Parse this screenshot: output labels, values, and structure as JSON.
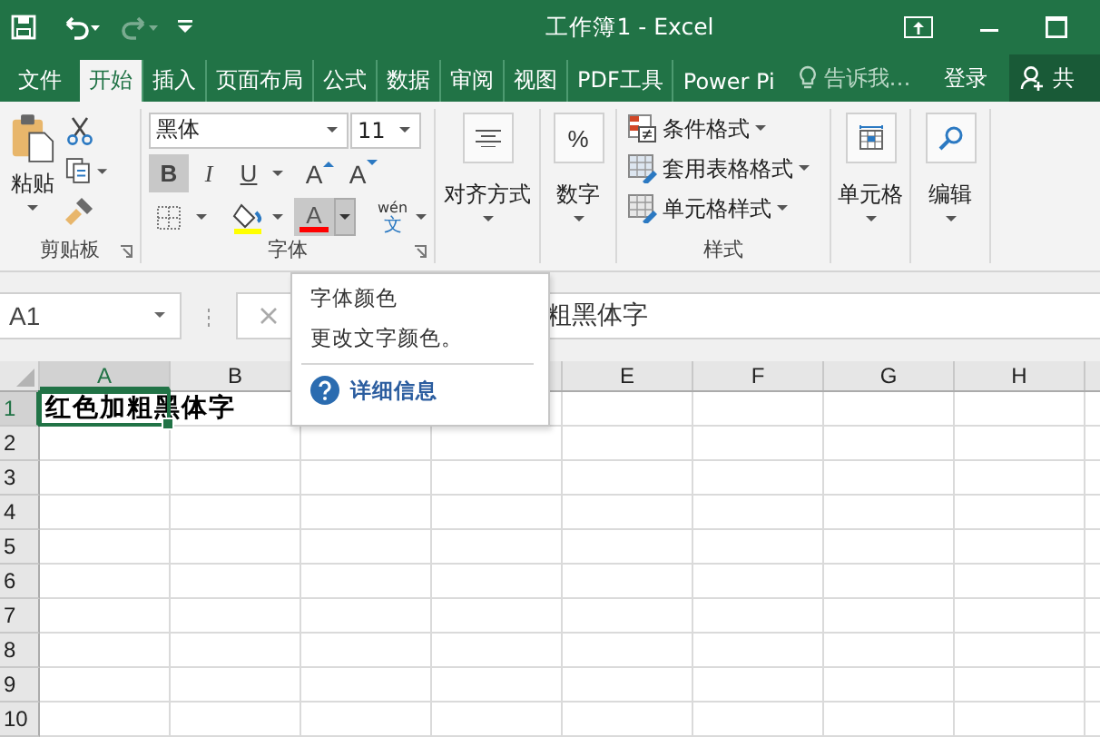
{
  "title_bar": {
    "title": "工作簿1 - Excel",
    "redo_disabled": true
  },
  "tabs": [
    {
      "label": "文件",
      "selected": false
    },
    {
      "label": "开始",
      "selected": true
    },
    {
      "label": "插入",
      "selected": false
    },
    {
      "label": "页面布局",
      "selected": false
    },
    {
      "label": "公式",
      "selected": false
    },
    {
      "label": "数据",
      "selected": false
    },
    {
      "label": "审阅",
      "selected": false
    },
    {
      "label": "视图",
      "selected": false
    },
    {
      "label": "PDF工具",
      "selected": false
    },
    {
      "label": "Power Pi",
      "selected": false
    }
  ],
  "tell_me": "告诉我…",
  "sign_in": "登录",
  "share": "共",
  "clipboard": {
    "label": "剪贴板",
    "paste": "粘贴"
  },
  "font": {
    "label": "字体",
    "font_name": "黑体",
    "font_size": "11",
    "style_buttons": [
      {
        "kind": "bold",
        "glyph": "B",
        "pressed": true
      },
      {
        "kind": "italic",
        "glyph": "I",
        "pressed": false
      },
      {
        "kind": "underline",
        "glyph": "U",
        "pressed": false
      }
    ],
    "grow_glyph": "A",
    "shrink_glyph": "A",
    "font_color_glyph": "A",
    "font_color_pressed": true,
    "phonetic_top": "wén",
    "phonetic_bottom": "文"
  },
  "alignment": {
    "label": "对齐方式"
  },
  "number": {
    "label": "数字",
    "symbol": "%"
  },
  "styles": {
    "label": "样式",
    "items": [
      {
        "kind": "conditional",
        "label": "条件格式"
      },
      {
        "kind": "table",
        "label": "套用表格格式"
      },
      {
        "kind": "cell",
        "label": "单元格样式"
      }
    ]
  },
  "cells": {
    "label": "单元格"
  },
  "editing": {
    "label": "编辑"
  },
  "formula_bar": {
    "name_box": "A1",
    "value": "粗黑体字"
  },
  "sheet": {
    "columns": [
      {
        "label": "A",
        "selected": true
      },
      {
        "label": "B",
        "selected": false
      },
      null,
      null,
      {
        "label": "E",
        "selected": false
      },
      {
        "label": "F",
        "selected": false
      },
      {
        "label": "G",
        "selected": false
      },
      {
        "label": "H",
        "selected": false
      }
    ],
    "rows": [
      {
        "label": "1",
        "selected": true,
        "cells": [
          {
            "text": "红色加粗黑体字",
            "bold": true,
            "selected": true
          }
        ]
      },
      {
        "label": "2",
        "selected": false
      },
      {
        "label": "3",
        "selected": false
      },
      {
        "label": "4",
        "selected": false
      },
      {
        "label": "5",
        "selected": false
      },
      {
        "label": "6",
        "selected": false
      },
      {
        "label": "7",
        "selected": false
      },
      {
        "label": "8",
        "selected": false
      },
      {
        "label": "9",
        "selected": false
      },
      {
        "label": "10",
        "selected": false
      }
    ]
  },
  "tooltip": {
    "title": "字体颜色",
    "description": "更改文字颜色。",
    "link": "详细信息"
  }
}
